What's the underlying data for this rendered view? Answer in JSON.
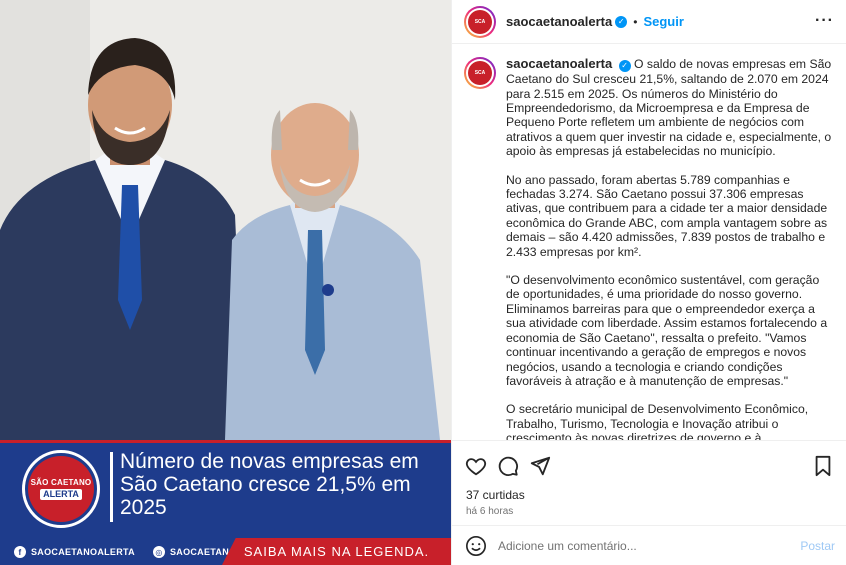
{
  "post": {
    "username": "saocaetanoalerta",
    "follow_label": "Seguir",
    "separator": "•",
    "more_icon": "more-horizontal-icon"
  },
  "media": {
    "logo_line1": "SÃO CAETANO",
    "logo_line2": "ALERTA",
    "headline": "Número de novas empresas em São Caetano cresce 21,5% em 2025",
    "social_facebook": "SAOCAETANOALERTA",
    "social_instagram": "SAOCAETANOALERTA",
    "cta": "SAIBA MAIS NA LEGENDA.",
    "colors": {
      "brand_blue": "#1e3c8c",
      "brand_red": "#c8202a"
    }
  },
  "caption": {
    "paragraph1": "O saldo de novas empresas em São Caetano do Sul cresceu 21,5%, saltando de 2.070 em 2024 para 2.515 em 2025. Os números do Ministério do Empreendedorismo, da Microempresa e da Empresa de Pequeno Porte refletem um ambiente de negócios com atrativos a quem quer investir na cidade e, especialmente, o apoio às empresas já estabelecidas no município.",
    "paragraph2": "No ano passado, foram abertas 5.789 companhias e fechadas 3.274. São Caetano possui 37.306 empresas ativas, que contribuem para a cidade ter a maior densidade econômica do Grande ABC, com ampla vantagem sobre as demais – são 4.420 admissões, 7.839 postos de trabalho e 2.433 empresas por km².",
    "paragraph3": "\"O desenvolvimento econômico sustentável, com geração de oportunidades, é uma prioridade do nosso governo. Eliminamos barreiras para que o empreendedor exerça a sua atividade com liberdade. Assim estamos fortalecendo a economia de São Caetano\", ressalta o prefeito. \"Vamos continuar incentivando a geração de empregos e novos negócios, usando a tecnologia e criando condições favoráveis à atração e à manutenção de empresas.\"",
    "paragraph4": "O secretário municipal de Desenvolvimento Econômico, Trabalho, Turismo, Tecnologia e Inovação atribui o crescimento às novas diretrizes de governo e à consolidação de políticas públicas voltadas. \"Apoiamos o empresário desde a"
  },
  "engagement": {
    "likes": "37 curtidas",
    "time_ago": "há 6 horas"
  },
  "comment": {
    "placeholder": "Adicione um comentário...",
    "post_label": "Postar"
  }
}
